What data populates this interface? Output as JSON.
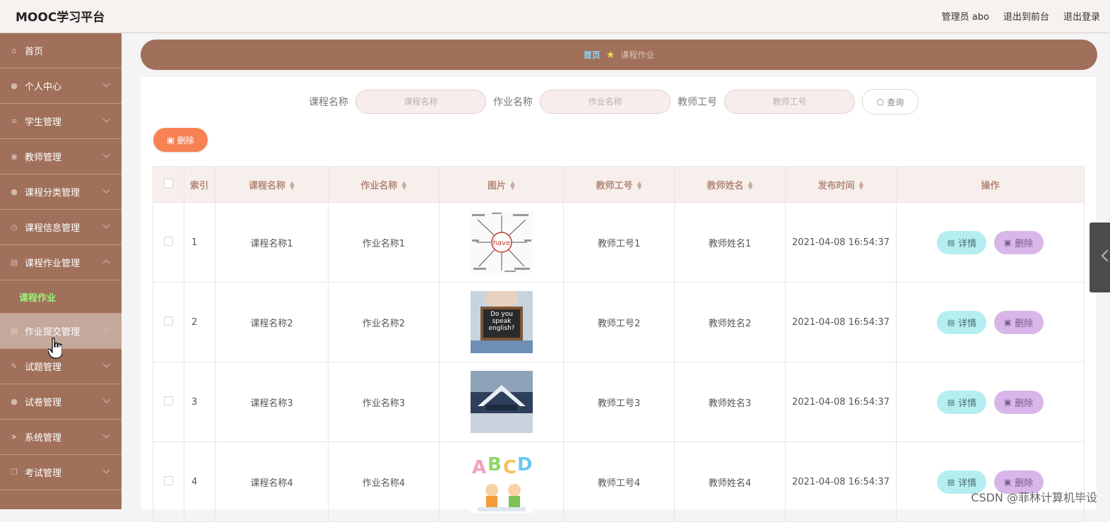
{
  "header": {
    "title": "MOOC学习平台",
    "admin": "管理员 abo",
    "front": "退出到前台",
    "logout": "退出登录"
  },
  "sidebar": {
    "items": [
      {
        "label": "首页",
        "icon": "home-icon",
        "chevron": false
      },
      {
        "label": "个人中心",
        "icon": "user-icon",
        "chevron": true
      },
      {
        "label": "学生管理",
        "icon": "list-icon",
        "chevron": true
      },
      {
        "label": "教师管理",
        "icon": "pin-icon",
        "chevron": true
      },
      {
        "label": "课程分类管理",
        "icon": "user-icon",
        "chevron": true
      },
      {
        "label": "课程信息管理",
        "icon": "clock-icon",
        "chevron": true
      },
      {
        "label": "课程作业管理",
        "icon": "clipboard-icon",
        "chevron": true,
        "expanded": true
      },
      {
        "label": "作业提交管理",
        "icon": "clipboard-icon",
        "chevron": true,
        "hover": true
      },
      {
        "label": "试题管理",
        "icon": "edit-icon",
        "chevron": true
      },
      {
        "label": "试卷管理",
        "icon": "user-icon",
        "chevron": true
      },
      {
        "label": "系统管理",
        "icon": "send-icon",
        "chevron": true
      },
      {
        "label": "考试管理",
        "icon": "copy-icon",
        "chevron": true
      }
    ],
    "submenu": "课程作业"
  },
  "breadcrumb": {
    "home": "首页",
    "current": "课程作业"
  },
  "search": {
    "course_label": "课程名称",
    "course_placeholder": "课程名称",
    "homework_label": "作业名称",
    "homework_placeholder": "作业名称",
    "teacher_label": "教师工号",
    "teacher_placeholder": "教师工号",
    "query": "查询"
  },
  "delete_label": "删除",
  "table": {
    "headers": [
      "索引",
      "课程名称",
      "作业名称",
      "图片",
      "教师工号",
      "教师姓名",
      "发布时间",
      "操作"
    ],
    "rows": [
      {
        "index": "1",
        "course": "课程名称1",
        "homework": "作业名称1",
        "teacher_id": "教师工号1",
        "teacher_name": "教师姓名1",
        "time": "2021-04-08 16:54:37",
        "img_text": "have"
      },
      {
        "index": "2",
        "course": "课程名称2",
        "homework": "作业名称2",
        "teacher_id": "教师工号2",
        "teacher_name": "教师姓名2",
        "time": "2021-04-08 16:54:37",
        "img_text": "Do you speak english?"
      },
      {
        "index": "3",
        "course": "课程名称3",
        "homework": "作业名称3",
        "teacher_id": "教师工号3",
        "teacher_name": "教师姓名3",
        "time": "2021-04-08 16:54:37",
        "img_text": ""
      },
      {
        "index": "4",
        "course": "课程名称4",
        "homework": "作业名称4",
        "teacher_id": "教师工号4",
        "teacher_name": "教师姓名4",
        "time": "2021-04-08 16:54:37",
        "img_text": "ABCD"
      }
    ],
    "detail_label": "详情",
    "remove_label": "删除"
  },
  "watermark": "CSDN @菲林计算机毕设",
  "colors": {
    "sidebar": "#a0705a",
    "accent_orange": "#f88254",
    "detail": "#b4eef0",
    "remove": "#d8b6ea"
  }
}
